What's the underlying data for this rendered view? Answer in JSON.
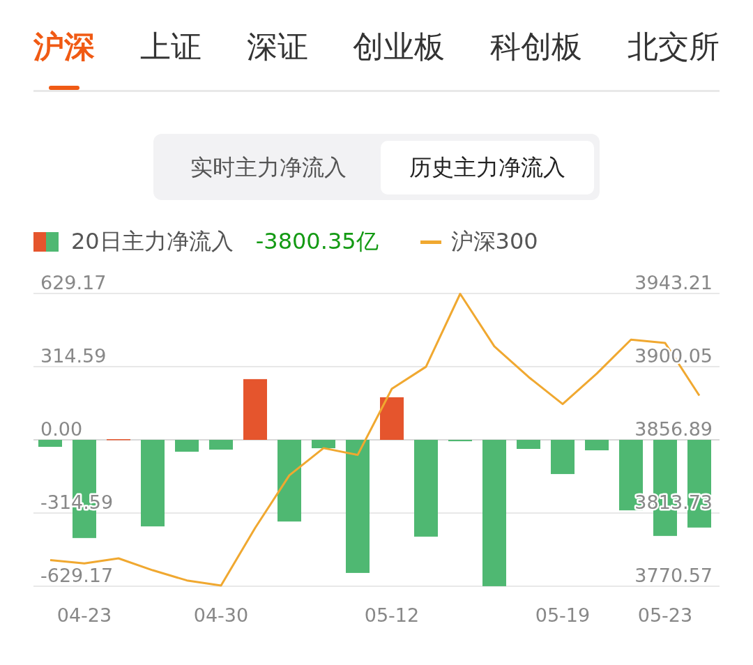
{
  "tabs": [
    {
      "label": "沪深",
      "selected": true
    },
    {
      "label": "上证",
      "selected": false
    },
    {
      "label": "深证",
      "selected": false
    },
    {
      "label": "创业板",
      "selected": false
    },
    {
      "label": "科创板",
      "selected": false
    },
    {
      "label": "北交所",
      "selected": false
    }
  ],
  "segments": [
    {
      "label": "实时主力净流入",
      "selected": false
    },
    {
      "label": "历史主力净流入",
      "selected": true
    }
  ],
  "flow_chart": {
    "legend_value": "-3800.35亿",
    "chart_data": {
      "type": "bar",
      "categories": [
        null,
        "04-23",
        null,
        null,
        null,
        "04-30",
        null,
        null,
        null,
        null,
        "05-12",
        null,
        null,
        null,
        null,
        "05-19",
        null,
        null,
        "05-23",
        null
      ],
      "ylim": [
        -629.17,
        629.17
      ],
      "yticks": [
        {
          "value": 629.17,
          "label": "629.17"
        },
        {
          "value": 314.59,
          "label": "314.59"
        },
        {
          "value": 0,
          "label": "0.00"
        },
        {
          "value": -314.59,
          "label": "-314.59"
        },
        {
          "value": -629.17,
          "label": "-629.17"
        }
      ],
      "series": [
        {
          "name": "20日主力净流入",
          "values": [
            -30,
            -422,
            3,
            -372,
            -51,
            -42,
            261,
            -351,
            -36,
            -572,
            183,
            -416,
            -6,
            -629,
            -39,
            -147,
            -45,
            -303,
            -413,
            -377
          ]
        }
      ]
    }
  },
  "index_chart": {
    "chart_data": {
      "type": "line",
      "categories": [
        null,
        null,
        null,
        null,
        null,
        null,
        null,
        null,
        null,
        null,
        null,
        null,
        null,
        null,
        null,
        null,
        null,
        null,
        null,
        null
      ],
      "ylim": [
        3770.57,
        3943.21
      ],
      "yticks": [
        {
          "value": 3943.21,
          "label": "3943.21"
        },
        {
          "value": 3900.05,
          "label": "3900.05"
        },
        {
          "value": 3856.89,
          "label": "3856.89"
        },
        {
          "value": 3813.73,
          "label": "3813.73"
        },
        {
          "value": 3770.57,
          "label": "3770.57"
        }
      ],
      "series": [
        {
          "name": "沪深300",
          "color": "#f0a830",
          "values": [
            3786,
            3784,
            3787,
            3780,
            3774,
            3771,
            3805,
            3836,
            3852,
            3848,
            3887,
            3900,
            3943,
            3912,
            3894,
            3878,
            3896,
            3916,
            3914,
            3883
          ]
        }
      ]
    }
  }
}
